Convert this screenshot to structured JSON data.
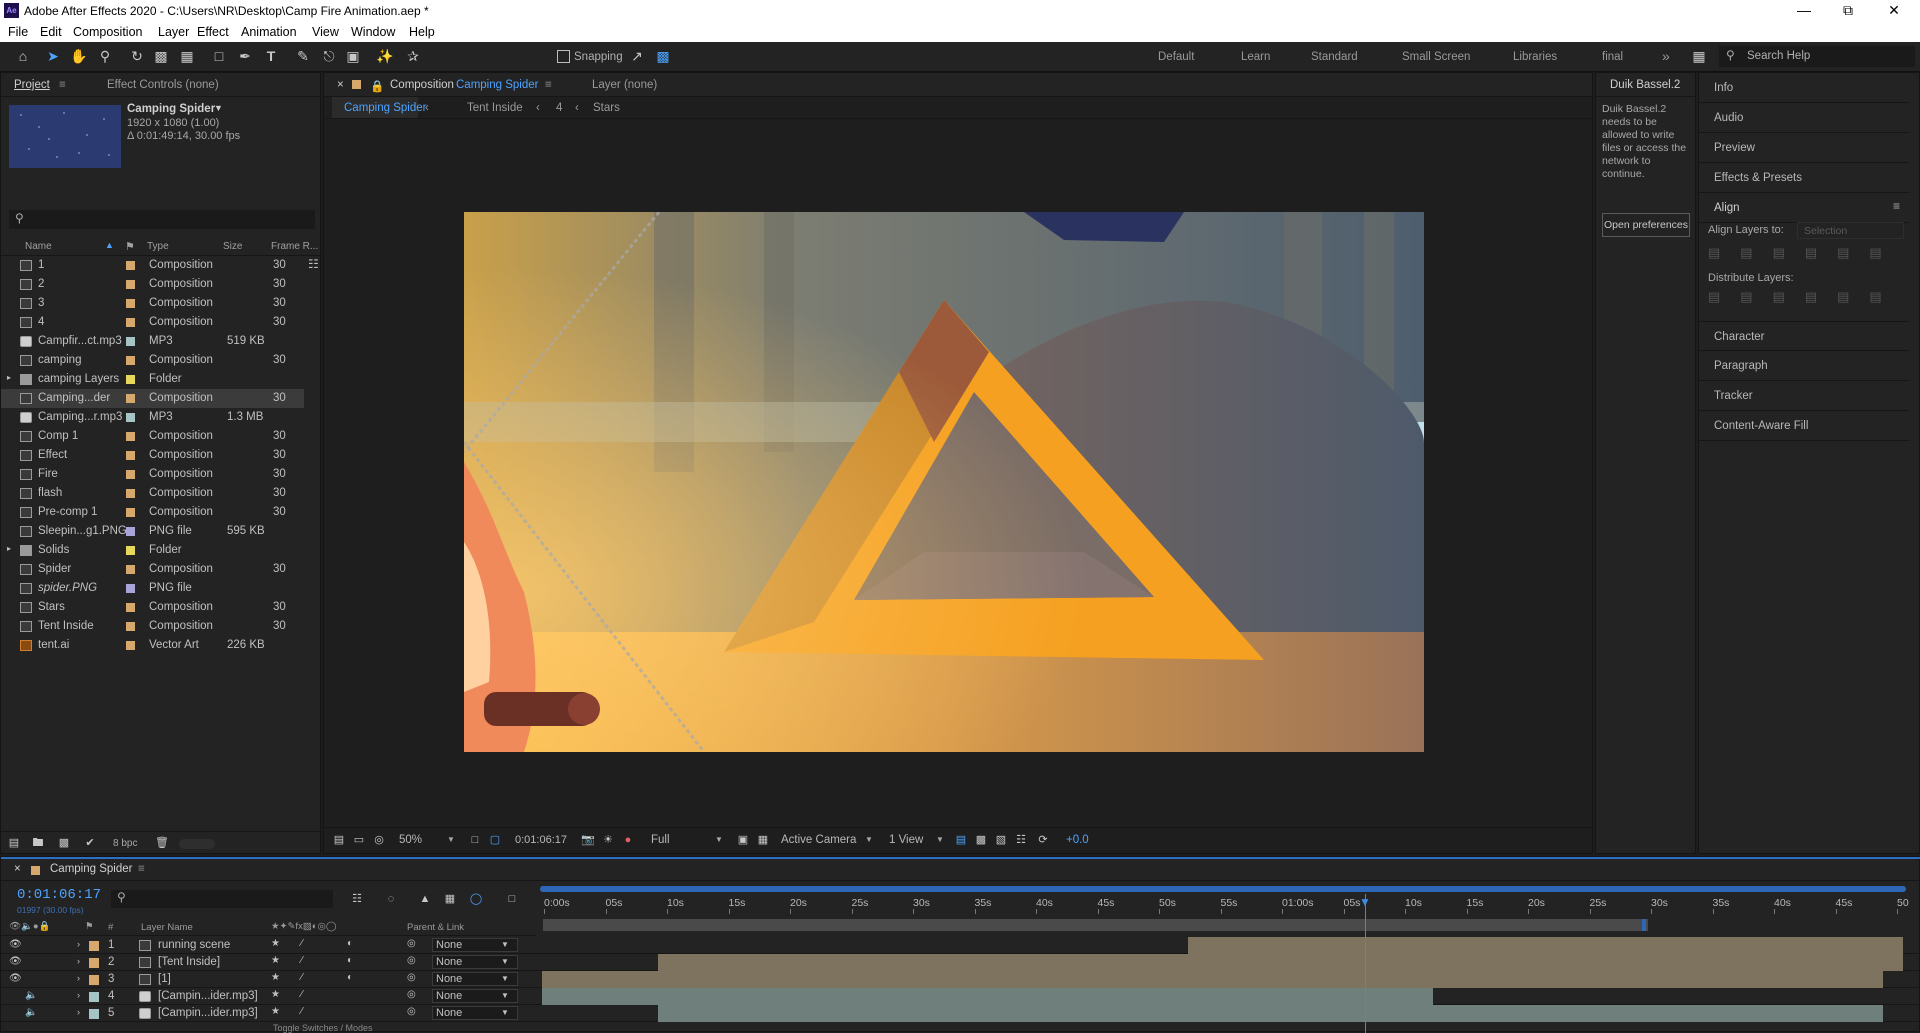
{
  "window": {
    "title": "Adobe After Effects 2020 - C:\\Users\\NR\\Desktop\\Camp Fire Animation.aep *",
    "app_badge": "Ae"
  },
  "menu": [
    "File",
    "Edit",
    "Composition",
    "Layer",
    "Effect",
    "Animation",
    "View",
    "Window",
    "Help"
  ],
  "toolbar": {
    "snapping": "Snapping",
    "workspaces": [
      "Default",
      "Learn",
      "Standard",
      "Small Screen",
      "Libraries",
      "final"
    ],
    "more": "»",
    "search_help": "Search Help"
  },
  "project": {
    "tab": "Project",
    "effect_controls": "Effect Controls (none)",
    "preview": {
      "name": "Camping Spider",
      "dims": "1920 x 1080 (1.00)",
      "duration": "Δ 0:01:49:14, 30.00 fps"
    },
    "search_placeholder": "",
    "columns": {
      "name": "Name",
      "type": "Type",
      "size": "Size",
      "frame": "Frame R..."
    },
    "items": [
      {
        "name": "1",
        "type": "Composition",
        "size": "",
        "frame": "30",
        "color": "#d6a86c",
        "kind": "comp"
      },
      {
        "name": "2",
        "type": "Composition",
        "size": "",
        "frame": "30",
        "color": "#d6a86c",
        "kind": "comp"
      },
      {
        "name": "3",
        "type": "Composition",
        "size": "",
        "frame": "30",
        "color": "#d6a86c",
        "kind": "comp"
      },
      {
        "name": "4",
        "type": "Composition",
        "size": "",
        "frame": "30",
        "color": "#d6a86c",
        "kind": "comp"
      },
      {
        "name": "Campfir...ct.mp3",
        "type": "MP3",
        "size": "519 KB",
        "frame": "",
        "color": "#a6c4c4",
        "kind": "audio"
      },
      {
        "name": "camping",
        "type": "Composition",
        "size": "",
        "frame": "30",
        "color": "#d6a86c",
        "kind": "comp"
      },
      {
        "name": "camping Layers",
        "type": "Folder",
        "size": "",
        "frame": "",
        "color": "#e5d85a",
        "kind": "folder"
      },
      {
        "name": "Camping...der",
        "type": "Composition",
        "size": "",
        "frame": "30",
        "color": "#d6a86c",
        "kind": "comp",
        "selected": true
      },
      {
        "name": "Camping...r.mp3",
        "type": "MP3",
        "size": "1.3 MB",
        "frame": "",
        "color": "#a6c4c4",
        "kind": "audio"
      },
      {
        "name": "Comp 1",
        "type": "Composition",
        "size": "",
        "frame": "30",
        "color": "#d6a86c",
        "kind": "comp"
      },
      {
        "name": "Effect",
        "type": "Composition",
        "size": "",
        "frame": "30",
        "color": "#d6a86c",
        "kind": "comp"
      },
      {
        "name": "Fire",
        "type": "Composition",
        "size": "",
        "frame": "30",
        "color": "#d6a86c",
        "kind": "comp"
      },
      {
        "name": "flash",
        "type": "Composition",
        "size": "",
        "frame": "30",
        "color": "#d6a86c",
        "kind": "comp"
      },
      {
        "name": "Pre-comp 1",
        "type": "Composition",
        "size": "",
        "frame": "30",
        "color": "#d6a86c",
        "kind": "comp"
      },
      {
        "name": "Sleepin...g1.PNG",
        "type": "PNG file",
        "size": "595 KB",
        "frame": "",
        "color": "#a8a3d8",
        "kind": "img"
      },
      {
        "name": "Solids",
        "type": "Folder",
        "size": "",
        "frame": "",
        "color": "#e5d85a",
        "kind": "folder"
      },
      {
        "name": "Spider",
        "type": "Composition",
        "size": "",
        "frame": "30",
        "color": "#d6a86c",
        "kind": "comp"
      },
      {
        "name": "spider.PNG",
        "type": "PNG file",
        "size": "",
        "frame": "",
        "color": "#a8a3d8",
        "kind": "img"
      },
      {
        "name": "Stars",
        "type": "Composition",
        "size": "",
        "frame": "30",
        "color": "#d6a86c",
        "kind": "comp"
      },
      {
        "name": "Tent Inside",
        "type": "Composition",
        "size": "",
        "frame": "30",
        "color": "#d6a86c",
        "kind": "comp"
      },
      {
        "name": "tent.ai",
        "type": "Vector Art",
        "size": "226 KB",
        "frame": "",
        "color": "#d6a86c",
        "kind": "ai"
      }
    ],
    "bpc": "8 bpc"
  },
  "viewer": {
    "comp_tab_prefix": "Composition",
    "comp_tab": "Camping Spider",
    "layer_tab": "Layer (none)",
    "breadcrumbs": [
      "Camping Spider",
      "Tent Inside",
      "4",
      "Stars"
    ],
    "zoom": "50%",
    "timecode": "0:01:06:17",
    "resolution": "Full",
    "camera": "Active Camera",
    "views": "1 View",
    "exposure": "+0.0"
  },
  "duik": {
    "tab": "Duik Bassel.2",
    "message": "Duik Bassel.2 needs to be allowed to write files or access the network to continue.",
    "button": "Open preferences"
  },
  "right_panels": {
    "items": [
      "Info",
      "Audio",
      "Preview",
      "Effects & Presets"
    ],
    "align": "Align",
    "align_to_label": "Align Layers to:",
    "align_to_value": "Selection",
    "distribute": "Distribute Layers:",
    "items2": [
      "Character",
      "Paragraph",
      "Tracker",
      "Content-Aware Fill"
    ]
  },
  "timeline": {
    "tab": "Camping Spider",
    "timecode": "0:01:06:17",
    "fps_sub": "01997 (30.00 fps)",
    "search_placeholder": "",
    "columns": {
      "layer_name": "Layer Name",
      "parent": "Parent & Link",
      "hash": "#"
    },
    "ruler": [
      "0:00s",
      "05s",
      "10s",
      "15s",
      "20s",
      "25s",
      "30s",
      "35s",
      "40s",
      "45s",
      "50s",
      "55s",
      "01:00s",
      "05s",
      "10s",
      "15s",
      "20s",
      "25s",
      "30s",
      "35s",
      "40s",
      "45s",
      "50"
    ],
    "layers": [
      {
        "index": "1",
        "name": "running scene",
        "parent": "None",
        "color": "#d6a86c"
      },
      {
        "index": "2",
        "name": "[Tent Inside]",
        "parent": "None",
        "color": "#d6a86c"
      },
      {
        "index": "3",
        "name": "[1]",
        "parent": "None",
        "color": "#d6a86c"
      },
      {
        "index": "4",
        "name": "[Campin...ider.mp3]",
        "parent": "None",
        "color": "#a6c4c4"
      },
      {
        "index": "5",
        "name": "[Campin...ider.mp3]",
        "parent": "None",
        "color": "#a6c4c4"
      }
    ],
    "footer": "Toggle Switches / Modes"
  }
}
